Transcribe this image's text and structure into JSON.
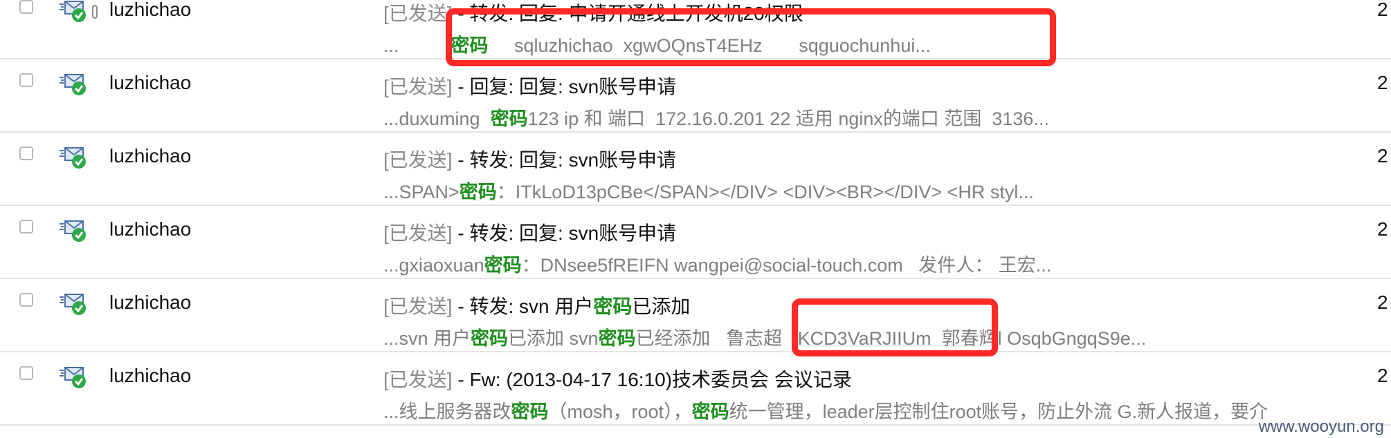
{
  "colors": {
    "keyword": "#1f8f1f",
    "highlight": "#ff2a26",
    "tag": "#8a8a8a",
    "divider": "#e4e4e4"
  },
  "rows": [
    {
      "sender": "luzhichao",
      "tag": "[已发送]",
      "subject_rest": " - 转发: 回复: 申请开通线上开发机20权限",
      "snippet": [
        {
          "t": "...          "
        },
        {
          "t": "密码",
          "kw": true
        },
        {
          "t": "     sqluzhichao  xgwOQnsT4EHz       sqguochunhui..."
        }
      ],
      "date": "2",
      "has_attachment": true
    },
    {
      "sender": "luzhichao",
      "tag": "[已发送]",
      "subject_rest": " - 回复: 回复: svn账号申请",
      "snippet": [
        {
          "t": "...duxuming  "
        },
        {
          "t": "密码",
          "kw": true
        },
        {
          "t": "123 ip 和 端口  172.16.0.201 22 适用 nginx的端口 范围  3136..."
        }
      ],
      "date": "2",
      "has_attachment": false
    },
    {
      "sender": "luzhichao",
      "tag": "[已发送]",
      "subject_rest": " - 转发: 回复: svn账号申请",
      "snippet": [
        {
          "t": "...SPAN>"
        },
        {
          "t": "密码",
          "kw": true
        },
        {
          "t": "：ITkLoD13pCBe</SPAN></DIV> <DIV><BR></DIV> <HR styl..."
        }
      ],
      "date": "2",
      "has_attachment": false
    },
    {
      "sender": "luzhichao",
      "tag": "[已发送]",
      "subject_rest": " - 转发: 回复: svn账号申请",
      "snippet": [
        {
          "t": "...gxiaoxuan"
        },
        {
          "t": "密码",
          "kw": true
        },
        {
          "t": "：DNsee5fREIFN wangpei@social-touch.com   发件人： 王宏..."
        }
      ],
      "date": "2",
      "has_attachment": false
    },
    {
      "sender": "luzhichao",
      "tag": "[已发送]",
      "subject_parts": [
        {
          "t": " - 转发: svn 用户"
        },
        {
          "t": "密码",
          "kw": true
        },
        {
          "t": "已添加"
        }
      ],
      "snippet": [
        {
          "t": "...svn 用户"
        },
        {
          "t": "密码",
          "kw": true
        },
        {
          "t": "已添加 svn"
        },
        {
          "t": "密码",
          "kw": true
        },
        {
          "t": "已经添加   鲁志超   KCD3VaRJIIUm  郭春辉l OsqbGngqS9e..."
        }
      ],
      "date": "2",
      "has_attachment": false
    },
    {
      "sender": "luzhichao",
      "tag": "[已发送]",
      "subject_rest": " - Fw: (2013-04-17 16:10)技术委员会 会议记录",
      "snippet": [
        {
          "t": "...线上服务器改"
        },
        {
          "t": "密码",
          "kw": true
        },
        {
          "t": "（mosh，root），"
        },
        {
          "t": "密码",
          "kw": true
        },
        {
          "t": "统一管理，leader层控制住root账号，防止外流 G.新人报道，要介"
        }
      ],
      "date": "2",
      "has_attachment": false
    }
  ],
  "watermark": "www.wooyun.org"
}
